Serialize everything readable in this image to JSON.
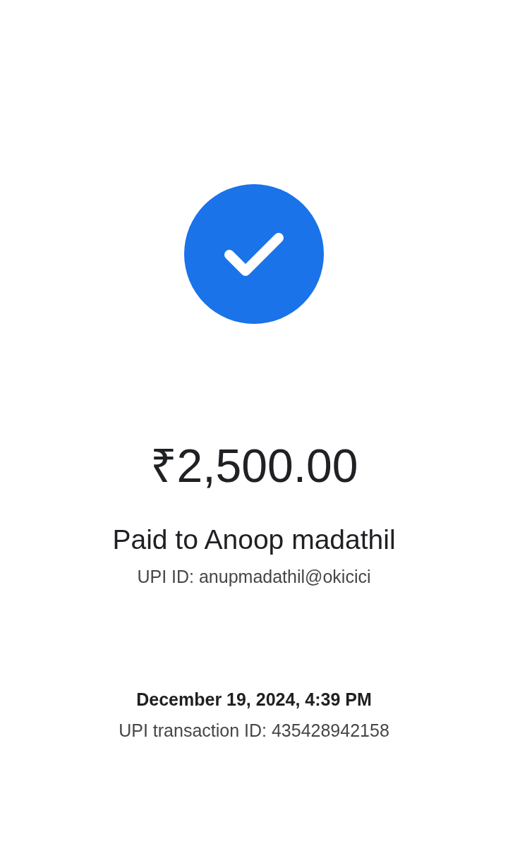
{
  "success": true,
  "amount": "₹2,500.00",
  "payee": "Paid to Anoop madathil",
  "upi_id": "UPI ID: anupmadathil@okicici",
  "date": "December 19, 2024, 4:39 PM",
  "transaction_id": "UPI transaction ID: 435428942158"
}
